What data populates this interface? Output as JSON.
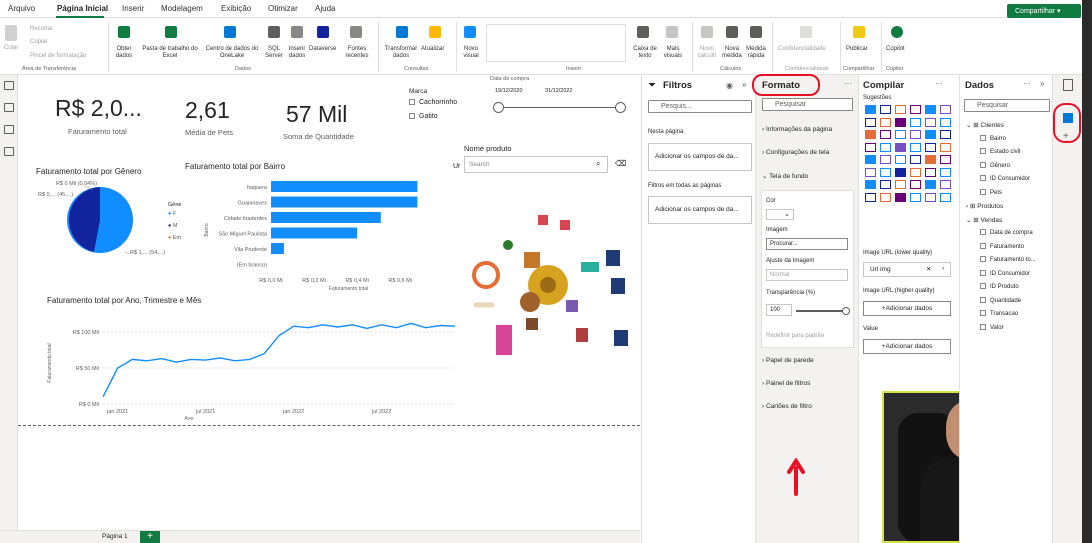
{
  "menu": {
    "items": [
      "Arquivo",
      "Página Inicial",
      "Inserir",
      "Modelagem",
      "Exibição",
      "Otimizar",
      "Ajuda"
    ],
    "share": "Compartilhar"
  },
  "ribbon": {
    "clipboard": {
      "paste": "Colar",
      "cut": "Recortar",
      "copy": "Copiar",
      "format_painter": "Pincel de formatação",
      "group": "Área de Transferência"
    },
    "data": {
      "get_data": "Obter dados",
      "excel": "Pasta de trabalho do Excel",
      "onelake": "Centro de dados do OneLake",
      "sql": "SQL Server",
      "enter": "Inserir dados",
      "dataverse": "Dataverse",
      "recent": "Fontes recentes",
      "group": "Dados"
    },
    "queries": {
      "transform": "Transformar dados",
      "refresh": "Atualizar",
      "group": "Consultas"
    },
    "insert": {
      "new_visual": "Novo visual",
      "text_box": "Caixa de texto",
      "more": "Mais visuais",
      "group": "Inserir"
    },
    "calc": {
      "new_calc": "Novo cálculo",
      "new_measure": "Nova medida",
      "quick_measure": "Medida rápida",
      "group": "Cálculos"
    },
    "sensitivity": {
      "label": "Confidencialidade",
      "group": "Confidencialidade"
    },
    "share": {
      "publish": "Publicar",
      "group": "Compartilhar"
    },
    "copilot": {
      "label": "Copilot",
      "group": "Copilot"
    }
  },
  "kpis": [
    {
      "value": "R$ 2,0...",
      "label": "Faturamento total"
    },
    {
      "value": "2,61",
      "label": "Média de Pets"
    },
    {
      "value": "57 Mil",
      "label": "Soma de Quantidade"
    }
  ],
  "slicer_marca": {
    "title": "Marca",
    "options": [
      "Cachorrinho",
      "Gatito"
    ]
  },
  "slicer_data": {
    "title": "Data de compra",
    "from": "19/12/2020",
    "to": "31/12/2022"
  },
  "slicer_produto": {
    "title": "Nome produto",
    "placeholder": "Search",
    "prefix": "Ur"
  },
  "pie": {
    "title": "Faturamento total por Gênero",
    "legend_title": "Gêne",
    "legend": [
      "F",
      "M",
      "Em"
    ],
    "labels": [
      "R$ 0 Mil (0,04%)",
      "R$ 0,... (45,...)",
      "R$ 1,... (54,...)"
    ]
  },
  "chart_data": [
    {
      "type": "bar",
      "title": "Faturamento total por Bairro",
      "ylabel": "Bairro",
      "xlabel": "Faturamento total",
      "categories": [
        "Itaquera",
        "Guaianases",
        "Cidade tiradentes",
        "São Miguel Paulista",
        "Vila Prudente",
        "(Em branco)"
      ],
      "values": [
        0.68,
        0.68,
        0.51,
        0.4,
        0.06,
        0
      ],
      "ticks": [
        "R$ 0,0 Mi",
        "R$ 0,2 Mi",
        "R$ 0,4 Mi",
        "R$ 0,6 Mi"
      ],
      "xlim": [
        0,
        0.72
      ]
    },
    {
      "type": "line",
      "title": "Faturamento total por Ano, Trimestre e Mês",
      "ylabel": "Faturamento total",
      "xlabel": "Ano",
      "yticks": [
        "R$ 0 Mil",
        "R$ 50 Mil",
        "R$ 100 Mil"
      ],
      "xticks": [
        "jan 2021",
        "jul 2021",
        "jan 2022",
        "jul 2022"
      ],
      "x": [
        1,
        2,
        3,
        4,
        5,
        6,
        7,
        8,
        9,
        10,
        11,
        12,
        13,
        14,
        15,
        16,
        17,
        18,
        19,
        20,
        21,
        22,
        23,
        24,
        25
      ],
      "values": [
        10,
        50,
        62,
        60,
        63,
        58,
        62,
        61,
        64,
        60,
        62,
        70,
        95,
        108,
        106,
        110,
        107,
        110,
        105,
        110,
        106,
        112,
        106,
        109,
        108
      ],
      "ylim": [
        0,
        125
      ]
    }
  ],
  "filters": {
    "title": "Filtros",
    "search": "Pesquis...",
    "this_page": "Nesta página",
    "add": "Adicionar os campos de da...",
    "all_pages": "Filtros em todas as páginas",
    "add2": "Adicionar os campos de da..."
  },
  "format": {
    "title": "Formato",
    "search": "Pesquisar",
    "sections": [
      "Informações da página",
      "Configurações de tela",
      "Tela de fundo"
    ],
    "color": "Cor",
    "image": "Imagem",
    "browse": "Procurar...",
    "fit": "Ajuste da Imagem",
    "fit_value": "Normal",
    "transparency": "Transparência (%)",
    "trans_value": "100",
    "reset": "Redefinir para padrão",
    "more": [
      "Papel de parede",
      "Painel de filtros",
      "Cartões de filtro"
    ]
  },
  "build": {
    "title": "Compilar",
    "suggestions": "Sugestões",
    "url_low": "Image URL (lower quality)",
    "url_value": "Url img",
    "url_high": "Image URL (higher quality)",
    "add": "+Adicionar dados",
    "value": "Value",
    "add2": "+Adicionar dados"
  },
  "data": {
    "title": "Dados",
    "search": "Pesquisar",
    "tables": [
      {
        "name": "Clientes",
        "fields": [
          "Bairro",
          "Estado civil",
          "Gênero",
          "ID Consumidor",
          "Pets"
        ]
      },
      {
        "name": "Produtos",
        "fields": []
      },
      {
        "name": "Vendas",
        "fields": [
          "Data de compra",
          "Faturamento",
          "Faturamento to...",
          "ID Consumidor",
          "ID Produto",
          "Quantidade",
          "Transacao",
          "Valor"
        ]
      }
    ]
  },
  "page_tab": "Página 1",
  "colors": {
    "accent": "#118dff",
    "dark": "#12239e",
    "orange": "#e66c37",
    "green": "#107c41"
  }
}
